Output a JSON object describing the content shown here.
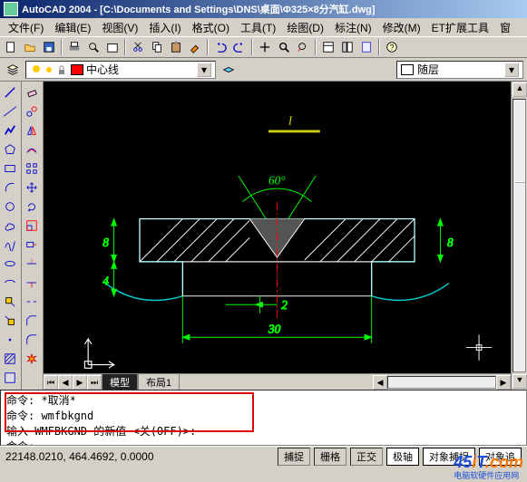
{
  "title": "AutoCAD 2004 - [C:\\Documents and Settings\\DNS\\桌面\\Φ325×8分汽缸.dwg]",
  "menu": {
    "file": "文件(F)",
    "edit": "编辑(E)",
    "view": "视图(V)",
    "insert": "插入(I)",
    "format": "格式(O)",
    "tools": "工具(T)",
    "draw": "绘图(D)",
    "dim": "标注(N)",
    "modify": "修改(M)",
    "et": "ET扩展工具",
    "win": "窗"
  },
  "layerbar": {
    "dropdown1": "中心线",
    "dropdown2": "随层"
  },
  "tabs": {
    "model": "模型",
    "layout1": "布局1"
  },
  "command": {
    "l1": "命令: *取消*",
    "l2": "命令:  wmfbkgnd",
    "l3": "输入 WMFBKGND 的新值 <关(OFF)>:",
    "l4": "命令:"
  },
  "status": {
    "coords": "22148.0210, 464.4692, 0.0000",
    "snap": "捕捉",
    "grid": "栅格",
    "ortho": "正交",
    "polar": "极轴",
    "osnap": "对象捕捉",
    "otrack": "对象追"
  },
  "drawing": {
    "angle": "60°",
    "d1": "8",
    "d2": "4",
    "d3": "2",
    "d4": "30",
    "d5": "8",
    "label": "I"
  },
  "watermark": {
    "brand": "45iT.com",
    "sub": "电脑软硬件应用网"
  }
}
